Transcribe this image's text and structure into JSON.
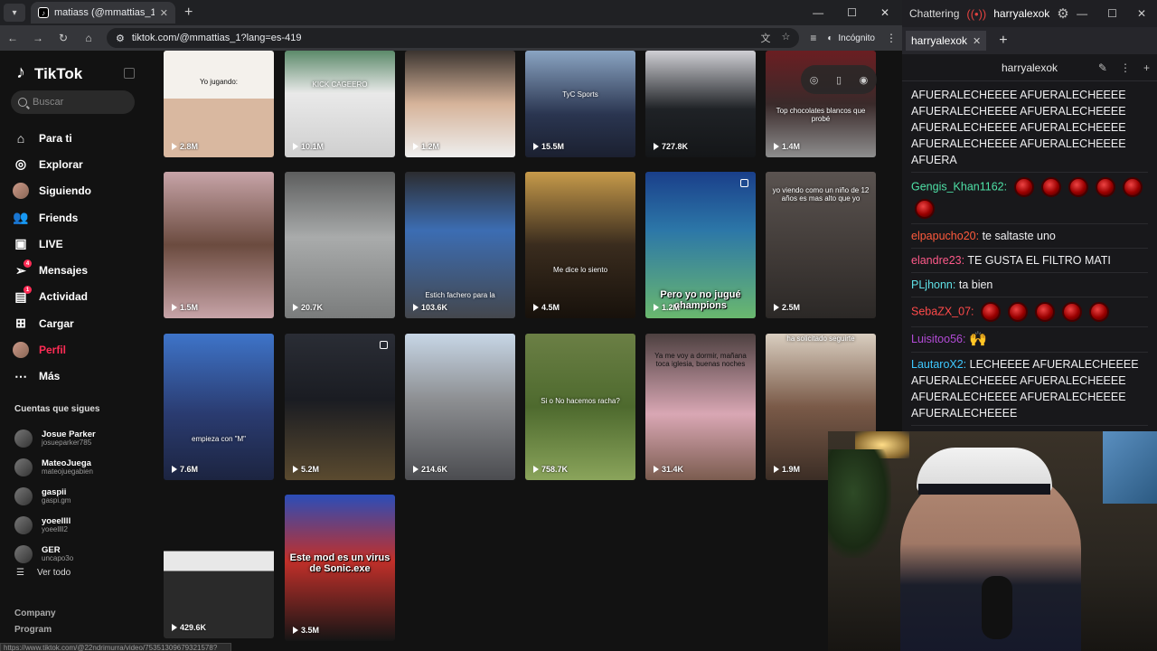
{
  "browser": {
    "tab_title": "matiass (@mmattias_1) | TikTok",
    "url": "tiktok.com/@mmattias_1?lang=es-419",
    "incognito_label": "Incógnito"
  },
  "tiktok": {
    "logo": "TikTok",
    "search_placeholder": "Buscar",
    "nav": [
      {
        "label": "Para ti",
        "icon": "home-icon"
      },
      {
        "label": "Explorar",
        "icon": "compass-icon"
      },
      {
        "label": "Siguiendo",
        "icon": "avatar-icon"
      },
      {
        "label": "Friends",
        "icon": "friends-icon"
      },
      {
        "label": "LIVE",
        "icon": "live-icon"
      },
      {
        "label": "Mensajes",
        "icon": "paper-plane-icon",
        "badge": "4"
      },
      {
        "label": "Actividad",
        "icon": "activity-icon",
        "badge": "1"
      },
      {
        "label": "Cargar",
        "icon": "plus-icon"
      },
      {
        "label": "Perfil",
        "icon": "profile-avatar-icon"
      },
      {
        "label": "Más",
        "icon": "more-icon"
      }
    ],
    "following_title": "Cuentas que sigues",
    "following": [
      {
        "name": "Josue Parker",
        "handle": "josueparker785"
      },
      {
        "name": "MateoJuega",
        "handle": "mateojuegabien"
      },
      {
        "name": "gaspii",
        "handle": "gaspi.gm"
      },
      {
        "name": "yoeellll",
        "handle": "yoeellll2"
      },
      {
        "name": "GER",
        "handle": "uncapo3o"
      }
    ],
    "see_all": "Ver todo",
    "footer_links": [
      "Company",
      "Program"
    ],
    "status_url": "https://www.tiktok.com/@22ndrimurra/video/75351309679321578?"
  },
  "videos": [
    {
      "views": "2.8M",
      "caption": "Yo jugando:"
    },
    {
      "views": "10.1M",
      "caption": "KICK CAGEERO"
    },
    {
      "views": "1.2M",
      "caption": ""
    },
    {
      "views": "15.5M",
      "caption": "TyC Sports"
    },
    {
      "views": "727.8K",
      "caption": ""
    },
    {
      "views": "1.4M",
      "caption": "Top chocolates blancos que probé"
    },
    {
      "views": "1.5M",
      "caption": ""
    },
    {
      "views": "20.7K",
      "caption": ""
    },
    {
      "views": "103.6K",
      "caption": "Estich fachero para la"
    },
    {
      "views": "4.5M",
      "caption": "Me dice lo siento"
    },
    {
      "views": "1.2M",
      "caption": "Pero yo no jugué champions"
    },
    {
      "views": "2.5M",
      "caption": "yo viendo como un niño de 12 años es mas alto que yo"
    },
    {
      "views": "7.6M",
      "caption": "empieza con \"M\""
    },
    {
      "views": "5.2M",
      "caption": ""
    },
    {
      "views": "214.6K",
      "caption": ""
    },
    {
      "views": "758.7K",
      "caption": "Si o No hacemos racha?"
    },
    {
      "views": "31.4K",
      "caption": "Ya me voy a dormir, mañana toca iglesia, buenas noches"
    },
    {
      "views": "1.9M",
      "caption": "ha solicitado seguirte"
    },
    {
      "views": "429.6K",
      "caption": ""
    },
    {
      "views": "3.5M",
      "caption": "Este mod es un virus de Sonic.exe"
    }
  ],
  "chat": {
    "app_name": "Chattering",
    "channel": "harryalexok",
    "tab_label": "harryalexok",
    "header_channel": "harryalexok",
    "messages": [
      {
        "author": "",
        "color": "#ffffff",
        "text": "AFUERALECHEEEE AFUERALECHEEEE AFUERALECHEEEE AFUERALECHEEEE AFUERALECHEEEE AFUERALECHEEEE AFUERALECHEEEE AFUERALECHEEEE AFUERA",
        "emotes": 0
      },
      {
        "author": "Gengis_Khan1162:",
        "color": "#4ee0a6",
        "text": "",
        "emotes": 6
      },
      {
        "author": "elpapucho20:",
        "color": "#ff5a3c",
        "text": "te saltaste uno",
        "emotes": 0
      },
      {
        "author": "elandre23:",
        "color": "#ff5a8a",
        "text": "TE GUSTA EL FILTRO MATI",
        "emotes": 0
      },
      {
        "author": "PLjhonn:",
        "color": "#5fe0e6",
        "text": "ta bien",
        "emotes": 0
      },
      {
        "author": "SebaZX_07:",
        "color": "#ff4a4a",
        "text": "",
        "emotes": 5
      },
      {
        "author": "Luisitoo56:",
        "color": "#b24bd6",
        "text": "",
        "emotes": 0,
        "hands": true
      },
      {
        "author": "LautaroX2:",
        "color": "#3ec8ff",
        "text": "LECHEEEE AFUERALECHEEEE AFUERALECHEEEE AFUERALECHEEEE AFUERALECHEEEE AFUERALECHEEEE AFUERALECHEEEE",
        "emotes": 0
      }
    ]
  }
}
